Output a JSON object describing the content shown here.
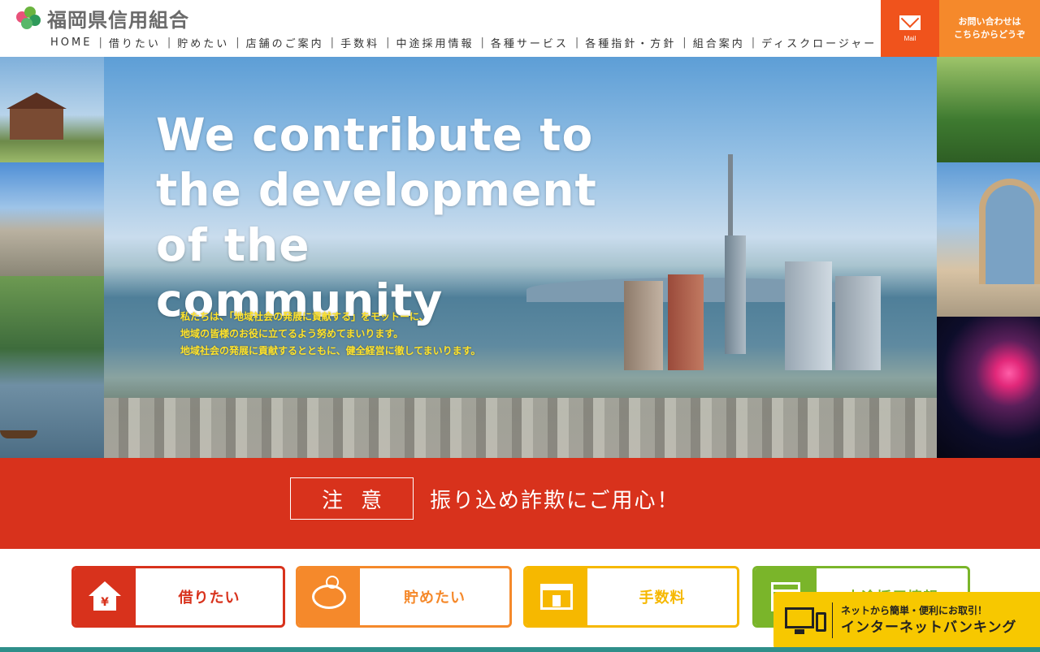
{
  "header": {
    "logo_text": "福岡県信用組合",
    "nav": [
      {
        "label": "HOME"
      },
      {
        "label": "借りたい"
      },
      {
        "label": "貯めたい"
      },
      {
        "label": "店舗のご案内"
      },
      {
        "label": "手数料"
      },
      {
        "label": "中途採用情報"
      },
      {
        "label": "各種サービス"
      },
      {
        "label": "各種指針・方針"
      },
      {
        "label": "組合案内"
      },
      {
        "label": "ディスクロージャー"
      }
    ],
    "mail_label": "Mail",
    "contact_line1": "お問い合わせは",
    "contact_line2": "こちらからどうぞ"
  },
  "hero": {
    "heading": "We contribute to the development of the community",
    "copy_line1": "私たちは、「地域社会の発展に貢献する」をモットーに、",
    "copy_line2": "地域の皆様のお役に立てるよう努めてまいります。",
    "copy_line3": "地域社会の発展に貢献するとともに、健全経営に徹してまいります。"
  },
  "warning": {
    "badge": "注意",
    "text": "振り込め詐欺にご用心！"
  },
  "categories": {
    "borrow": "借りたい",
    "save": "貯めたい",
    "fee": "手数料",
    "job": "中途採用情報",
    "yen": "¥"
  },
  "netbank": {
    "sub": "ネットから簡単・便利にお取引！",
    "main": "インターネットバンキング"
  },
  "colors": {
    "warning_red": "#d8321c",
    "orange": "#f5892b",
    "mail_orange": "#f0531c",
    "yellow": "#f6b800",
    "green": "#7ab52a",
    "netbank_yellow": "#f7c800"
  }
}
